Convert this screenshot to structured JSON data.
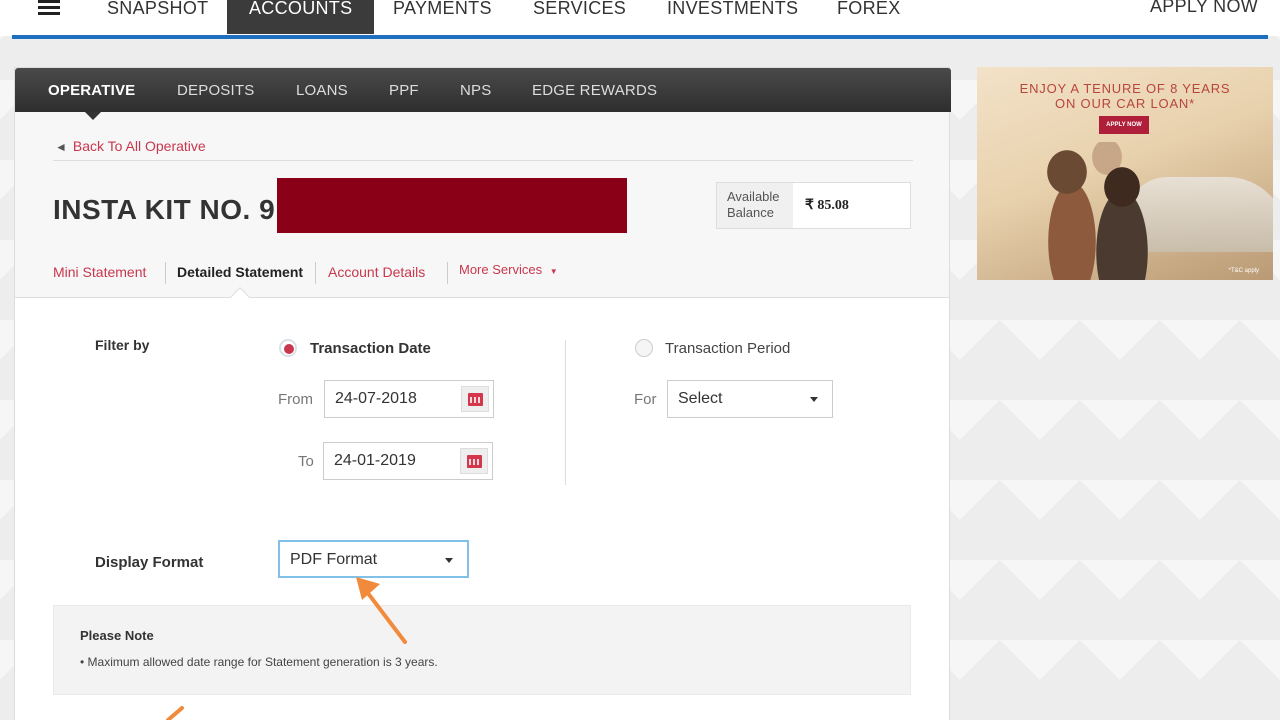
{
  "topnav": {
    "items": [
      "SNAPSHOT",
      "ACCOUNTS",
      "PAYMENTS",
      "SERVICES",
      "INVESTMENTS",
      "FOREX"
    ],
    "active": "ACCOUNTS",
    "apply_now": "APPLY NOW"
  },
  "subnav": {
    "items": [
      "OPERATIVE",
      "DEPOSITS",
      "LOANS",
      "PPF",
      "NPS",
      "EDGE REWARDS"
    ],
    "active": "OPERATIVE"
  },
  "back_link": "Back To All Operative",
  "account": {
    "title": "INSTA KIT NO. 9",
    "balance_label": "Available Balance",
    "balance_value": "₹ 85.08"
  },
  "account_tabs": {
    "mini_statement": "Mini Statement",
    "detailed_statement": "Detailed Statement",
    "account_details": "Account Details",
    "more_services": "More Services"
  },
  "filter": {
    "label": "Filter by",
    "transaction_date": "Transaction Date",
    "transaction_period": "Transaction Period",
    "from_label": "From",
    "from_value": "24-07-2018",
    "to_label": "To",
    "to_value": "24-01-2019",
    "for_label": "For",
    "for_value": "Select"
  },
  "display_format": {
    "label": "Display Format",
    "value": "PDF Format"
  },
  "note": {
    "title": "Please Note",
    "text": "• Maximum allowed date range for Statement generation is 3 years."
  },
  "ad": {
    "line1": "ENJOY A TENURE OF 8 YEARS",
    "line2": "ON OUR CAR LOAN*",
    "button": "APPLY NOW",
    "tc": "*T&C apply"
  },
  "colors": {
    "accent": "#c8374e",
    "nav_active_bg": "#3b3b3b",
    "nav_underline": "#1c6fc1",
    "redaction": "#8a0017",
    "annotation_arrow": "#f28a3c"
  }
}
